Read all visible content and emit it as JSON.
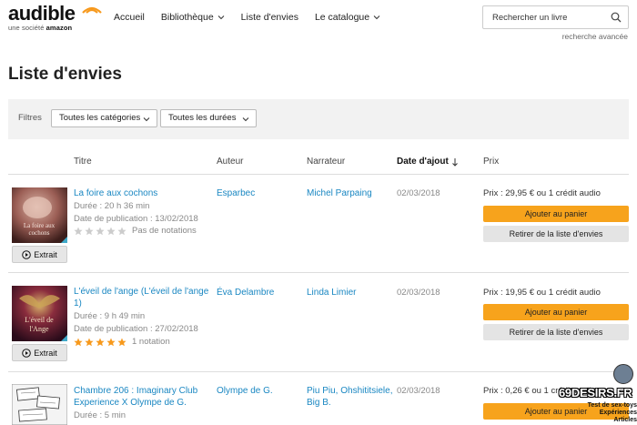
{
  "brand": {
    "name": "audible",
    "tagline": "une société",
    "parent": "amazon"
  },
  "nav": [
    {
      "label": "Accueil"
    },
    {
      "label": "Bibliothèque"
    },
    {
      "label": "Liste d'envies"
    },
    {
      "label": "Le catalogue"
    }
  ],
  "search": {
    "placeholder": "Rechercher un livre",
    "advanced_label": "recherche avancée"
  },
  "page": {
    "title": "Liste d'envies"
  },
  "filters": {
    "label": "Filtres",
    "category": "Toutes les catégories",
    "duration": "Toutes les durées"
  },
  "columns": {
    "title": "Titre",
    "author": "Auteur",
    "narrator": "Narrateur",
    "date": "Date d'ajout",
    "price": "Prix"
  },
  "items": [
    {
      "title": "La foire aux cochons",
      "duration": "Durée : 20 h 36 min",
      "published": "Date de publication : 13/02/2018",
      "rating_text": "Pas de notations",
      "rating": 0,
      "author": "Esparbec",
      "narrator": "Michel Parpaing",
      "date_added": "02/03/2018",
      "price": "Prix : 29,95 € ou 1 crédit audio",
      "cover_text": "La foire aux cochons",
      "extract_label": "Extrait"
    },
    {
      "title": "L'éveil de l'ange (L'éveil de l'ange 1)",
      "duration": "Durée : 9 h 49 min",
      "published": "Date de publication : 27/02/2018",
      "rating_text": "1 notation",
      "rating": 5,
      "author": "Éva Delambre",
      "narrator": "Linda Limier",
      "date_added": "02/03/2018",
      "price": "Prix : 19,95 € ou 1 crédit audio",
      "cover_text": "L'éveil de l'Ange",
      "extract_label": "Extrait"
    },
    {
      "title": "Chambre 206 : Imaginary Club Experience X Olympe de G.",
      "duration": "Durée : 5 min",
      "author": "Olympe de G.",
      "narrator": "Piu Piu, Ohshititsiele, Big B.",
      "date_added": "02/03/2018",
      "price": "Prix : 0,26 € ou 1 crédit audio"
    }
  ],
  "actions": {
    "add_to_cart": "Ajouter au panier",
    "remove": "Retirer de la liste d'envies"
  },
  "watermark": {
    "title": "69DESIRS.FR",
    "line1": "Test de sex-toys",
    "line2": "Expériences",
    "line3": "Articles"
  },
  "colors": {
    "link": "#1a87c2",
    "cart": "#f7a31c",
    "brand_orange": "#f7991c"
  }
}
